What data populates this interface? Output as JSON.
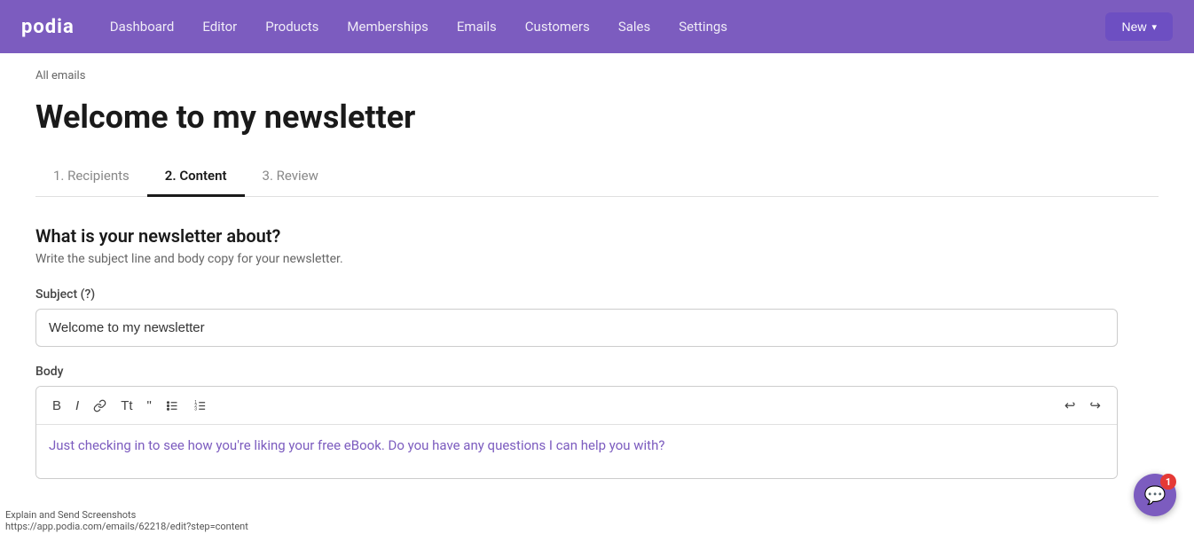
{
  "brand": {
    "logo": "podia"
  },
  "navbar": {
    "links": [
      {
        "label": "Dashboard",
        "id": "dashboard"
      },
      {
        "label": "Editor",
        "id": "editor"
      },
      {
        "label": "Products",
        "id": "products"
      },
      {
        "label": "Memberships",
        "id": "memberships"
      },
      {
        "label": "Emails",
        "id": "emails"
      },
      {
        "label": "Customers",
        "id": "customers"
      },
      {
        "label": "Sales",
        "id": "sales"
      },
      {
        "label": "Settings",
        "id": "settings"
      }
    ],
    "cta_label": "New",
    "cta_chevron": "▾"
  },
  "breadcrumb": {
    "text": "All emails"
  },
  "page": {
    "title": "Welcome to my newsletter"
  },
  "tabs": [
    {
      "label": "1. Recipients",
      "id": "recipients",
      "active": false
    },
    {
      "label": "2. Content",
      "id": "content",
      "active": true
    },
    {
      "label": "3. Review",
      "id": "review",
      "active": false
    }
  ],
  "section": {
    "heading": "What is your newsletter about?",
    "description": "Write the subject line and body copy for your newsletter."
  },
  "fields": {
    "subject_label": "Subject (?)",
    "subject_value": "Welcome to my newsletter",
    "body_label": "Body"
  },
  "toolbar": {
    "bold": "B",
    "italic": "I",
    "link": "🔗",
    "text_style": "Tt",
    "quote": "❝",
    "bullet_list": "≡",
    "ordered_list": "≣",
    "undo": "↩",
    "redo": "↪"
  },
  "body_content": "Just checking in to see how you're liking your free eBook. Do you have any questions I can help you with?",
  "chat": {
    "badge": "1"
  },
  "status_bar": {
    "tooltip": "Explain and Send Screenshots",
    "url": "https://app.podia.com/emails/62218/edit?step=content"
  }
}
